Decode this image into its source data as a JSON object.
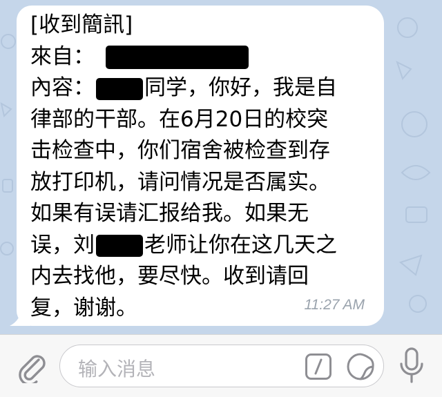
{
  "message": {
    "lines": {
      "l1": "[收到簡訊]",
      "l2_label": "來自：",
      "l3_label": "內容：",
      "l3_text": "同学，你好，我是自",
      "l4": "律部的干部。在6月20日的校突",
      "l5": "击检查中，你们宿舍被检查到存",
      "l6": "放打印机，请问情况是否属实。",
      "l7": "如果有误请汇报给我。如果无",
      "l8_pre": "误，刘",
      "l8_post": "老师让你在这几天之",
      "l9": "内去找他，要尽快。收到请回",
      "l10": "复，谢谢。"
    },
    "time": "11:27 AM"
  },
  "input": {
    "placeholder": "输入消息"
  },
  "icons": {
    "attach": "paperclip-icon",
    "command": "slash-command-icon",
    "sticker": "sticker-icon",
    "mic": "microphone-icon"
  },
  "colors": {
    "chat_background": "#c5d6ea",
    "bubble": "#ffffff",
    "icon_gray": "#8e8e93",
    "time": "#9aa3ad"
  }
}
